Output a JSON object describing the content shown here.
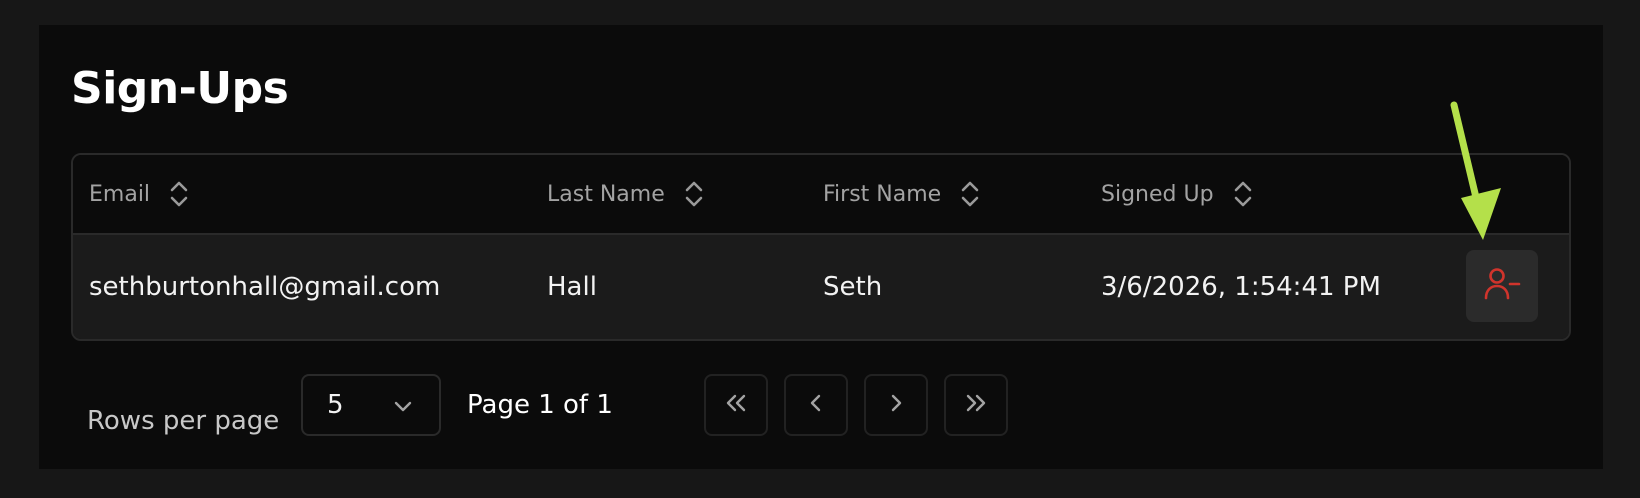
{
  "page": {
    "title": "Sign-Ups"
  },
  "table": {
    "columns": [
      "Email",
      "Last Name",
      "First Name",
      "Signed Up"
    ],
    "rows": [
      {
        "email": "sethburtonhall@gmail.com",
        "last_name": "Hall",
        "first_name": "Seth",
        "signed_up": "3/6/2026, 1:54:41 PM"
      }
    ],
    "row_action_icon": "user-minus-icon"
  },
  "pagination": {
    "rows_per_page_label": "Rows per page",
    "rows_per_page_value": "5",
    "page_info": "Page 1 of 1",
    "buttons": [
      "first-page-icon",
      "previous-page-icon",
      "next-page-icon",
      "last-page-icon"
    ]
  },
  "colors": {
    "background": "#171717",
    "card": "#0b0b0b",
    "row": "#1b1b1b",
    "destructive": "#d0342c",
    "annotation_arrow": "#b4e04a"
  }
}
